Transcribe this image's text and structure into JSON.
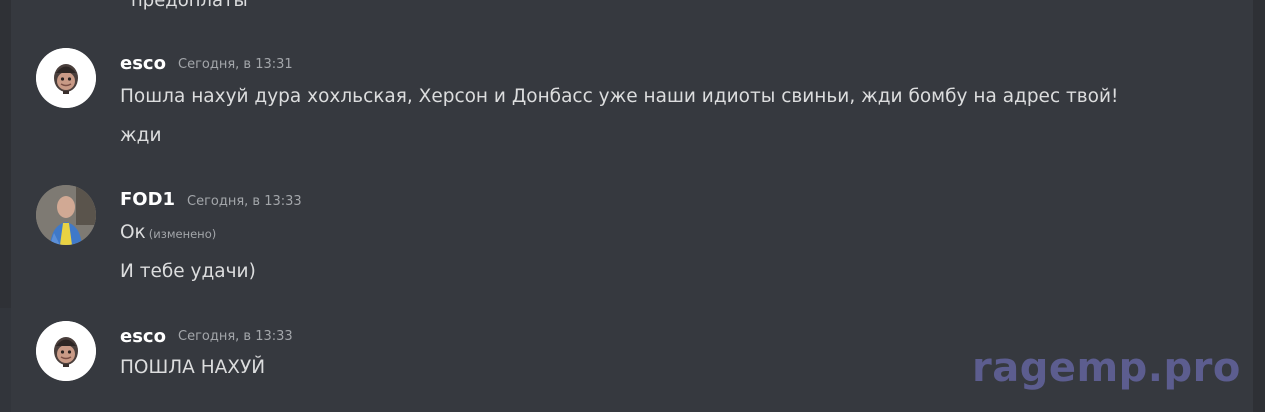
{
  "chat": {
    "previous_line_fragment": "предоплаты",
    "messages": [
      {
        "author": "esco",
        "timestamp": "Сегодня, в 13:31",
        "lines": [
          "Пошла нахуй дура хохльская, Херсон и Донбасс уже наши идиоты свиньи, жди бомбу на адрес твой!",
          "жди"
        ]
      },
      {
        "author": "FOD1",
        "timestamp": "Сегодня, в 13:33",
        "lines": [
          "Ок",
          "И тебе удачи)"
        ],
        "edited_label": "(изменено)"
      },
      {
        "author": "esco",
        "timestamp": "Сегодня, в 13:33",
        "lines": [
          "ПОШЛА НАХУЙ"
        ]
      }
    ]
  },
  "watermark": "ragemp.pro",
  "colors": {
    "background": "#36393f",
    "username": "#ffffff",
    "message_text": "#dcddde",
    "timestamp": "#a3a6aa",
    "watermark": "#5c5d8f"
  }
}
